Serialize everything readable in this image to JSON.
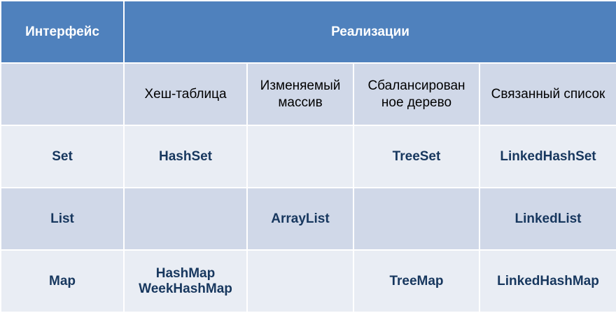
{
  "header": {
    "interface": "Интерфейс",
    "implementations": "Реализации"
  },
  "subheader": {
    "hash_table": "Хеш-таблица",
    "resizable_array": "Изменяемый массив",
    "balanced_tree": "Сбалансирован ное дерево",
    "linked_list": "Связанный список"
  },
  "rows": [
    {
      "interface": "Set",
      "hash_table": "HashSet",
      "resizable_array": "",
      "balanced_tree": "TreeSet",
      "linked_list": "LinkedHashSet"
    },
    {
      "interface": "List",
      "hash_table": "",
      "resizable_array": "ArrayList",
      "balanced_tree": "",
      "linked_list": "LinkedList"
    },
    {
      "interface": "Map",
      "hash_table_line1": "HashMap",
      "hash_table_line2": "WeekHashMap",
      "resizable_array": "",
      "balanced_tree": "TreeMap",
      "linked_list": "LinkedHashMap"
    }
  ],
  "colors": {
    "header_bg": "#4f81bd",
    "header_text": "#ffffff",
    "row_dark": "#d0d8e8",
    "row_light": "#e9edf4",
    "body_text": "#17375e"
  }
}
